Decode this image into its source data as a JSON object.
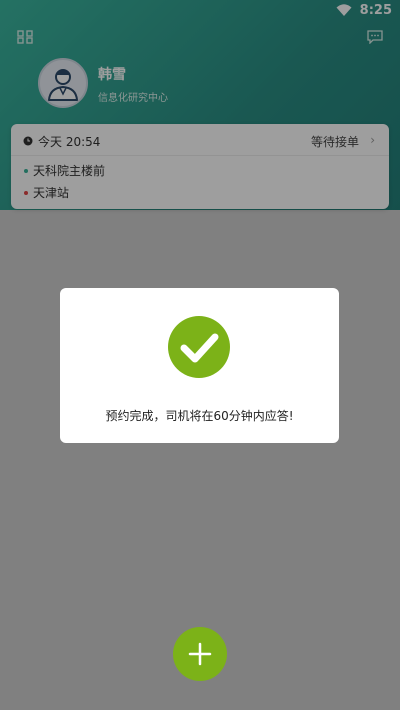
{
  "statusbar": {
    "time": "8:25"
  },
  "user": {
    "name": "韩雪",
    "department": "信息化研究中心"
  },
  "order": {
    "time": "今天 20:54",
    "status": "等待接单",
    "from": "天科院主楼前",
    "to": "天津站"
  },
  "dialog": {
    "message": "预约完成，司机将在60分钟内应答!"
  },
  "colors": {
    "header": "#2a8e84",
    "accent": "#7cb218",
    "start_dot": "#39b49a",
    "end_dot": "#e04848"
  },
  "icons": {
    "grid": "grid-icon",
    "message": "message-icon",
    "wifi": "wifi-icon",
    "avatar": "user-avatar-icon",
    "clock": "clock-icon",
    "check": "check-circle-icon",
    "add": "plus-icon"
  }
}
